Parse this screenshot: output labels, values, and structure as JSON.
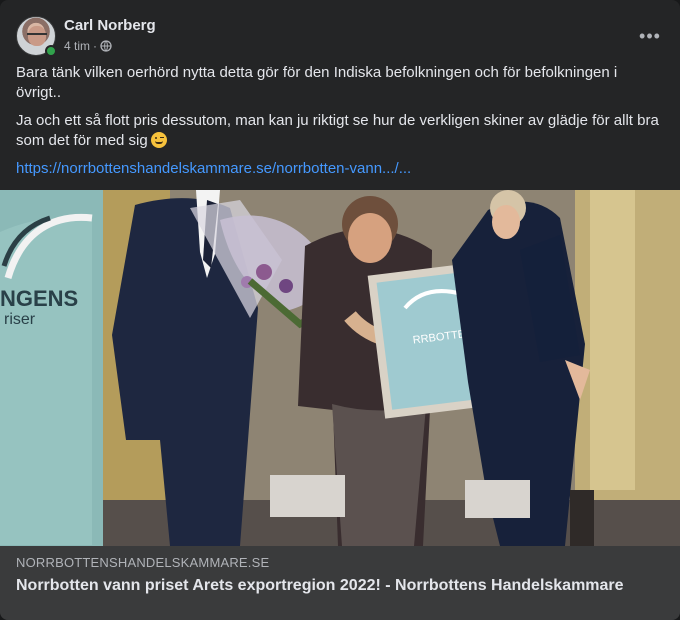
{
  "post": {
    "author": "Carl Norberg",
    "time": "4 tim",
    "separator": "·",
    "more_icon": "more-options-icon",
    "paragraph_1": "Bara tänk vilken oerhörd nytta detta gör för den Indiska befolkningen och för befolkningen i övrigt..",
    "paragraph_2": "Ja och ett så flott pris dessutom, man kan ju riktigt se hur de verkligen skiner av glädje för allt bra som det för med sig",
    "link": "https://norrbottenshandelskammare.se/norrbotten-vann.../..."
  },
  "photo": {
    "banner_text_1": "NGENS",
    "banner_text_2": "riser",
    "frame_text": "RRBOTTEN"
  },
  "link_preview": {
    "domain": "NORRBOTTENSHANDELSKAMMARE.SE",
    "title": "Norrbotten vann priset Arets exportregion 2022! - Norrbottens Handelskammare"
  },
  "colors": {
    "background": "#242526",
    "link": "#4599ff",
    "online": "#31a24c"
  }
}
